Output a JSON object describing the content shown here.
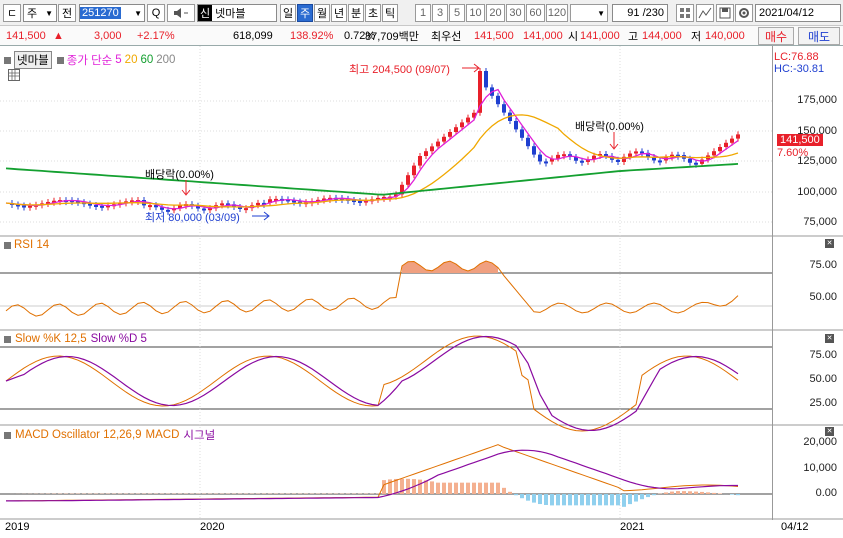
{
  "toolbar": {
    "logo_glyph": "ㄷ",
    "market_select": "주",
    "prev_label": "전",
    "stock_code": "251270",
    "search_glyph": "Q",
    "stock_badge": "신",
    "stock_name": "넷마블",
    "period_tabs": [
      "일",
      "주",
      "월",
      "년",
      "분",
      "초",
      "틱"
    ],
    "active_period": "주",
    "interval_buttons": [
      "1",
      "3",
      "5",
      "10",
      "20",
      "30",
      "60",
      "120"
    ],
    "count_display": "91 /230",
    "date": "2021/04/12"
  },
  "quote": {
    "price": "141,500",
    "change_arrow": "▲",
    "change": "3,000",
    "change_pct": "+2.17%",
    "volume": "618,099",
    "volume_ratio": "138.92%",
    "turnover": "0.72%",
    "amount": "87,709백만",
    "best_label": "최우선",
    "ask": "141,500",
    "bid": "141,000",
    "open_label": "시",
    "open": "141,000",
    "high_label": "고",
    "high": "144,000",
    "low_label": "저",
    "low": "140,000",
    "buy_label": "매수",
    "sell_label": "매도"
  },
  "price_panel": {
    "name_tag": "넷마블",
    "indicator_label": "종가 단순",
    "ma_periods": [
      "5",
      "20",
      "60",
      "200"
    ],
    "ma_colors": [
      "#e020d8",
      "#f0a800",
      "#14a030",
      "#888888"
    ],
    "high_annotation": "최고 204,500 (09/07)",
    "low_annotation": "최저 80,000 (03/09)",
    "dividend_annotation_1": "배당락(0.00%)",
    "dividend_annotation_2": "배당락(0.00%)",
    "lc_label": "LC:76.88",
    "hc_label": "HC:-30.81",
    "axis_ticks": [
      "175,000",
      "150,000",
      "125,000",
      "100,000",
      "75,000"
    ],
    "current_price_tag": "141,500",
    "current_pct_tag": "7.60%"
  },
  "rsi_panel": {
    "title": "RSI 14",
    "axis_ticks": [
      "75.00",
      "50.00"
    ]
  },
  "stoch_panel": {
    "title": "Slow %K 12,5",
    "title2": "Slow %D 5",
    "axis_ticks": [
      "75.00",
      "50.00",
      "25.00"
    ]
  },
  "macd_panel": {
    "title": "MACD Oscillator 12,26,9",
    "title2": "MACD",
    "title3": "시그널",
    "axis_ticks": [
      "20,000",
      "10,000",
      "0.00"
    ]
  },
  "x_axis": {
    "labels": [
      "2019",
      "2020",
      "2021"
    ],
    "right_label": "04/12"
  },
  "colors": {
    "up": "#e8202a",
    "down": "#1f3fd0",
    "accent": "#2a6bd1"
  }
}
